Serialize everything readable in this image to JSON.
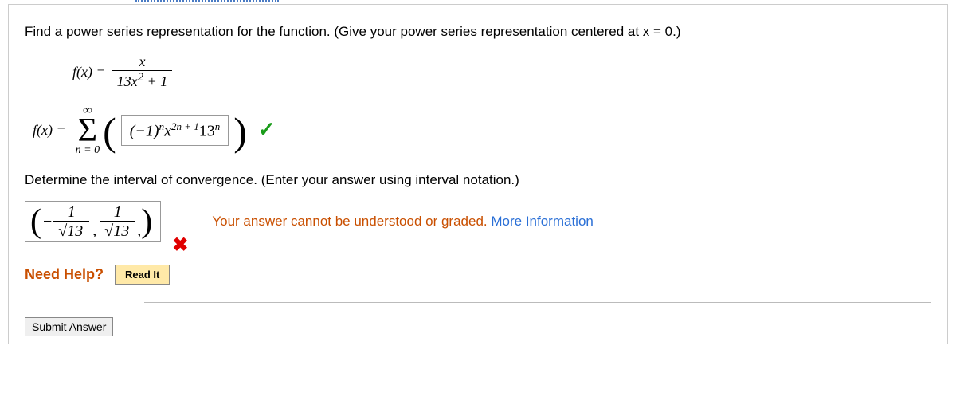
{
  "problem": {
    "prompt": "Find a power series representation for the function. (Give your power series representation centered at x = 0.)",
    "fx_equals": "f(x) =",
    "fraction": {
      "num": "x",
      "den_a": "13x",
      "den_exp": "2",
      "den_b": " + 1"
    },
    "series_label": "f(x) =",
    "sum": {
      "top": "∞",
      "bottom": "n = 0"
    },
    "series_answer": {
      "neg1": "(−1)",
      "exp1": "n",
      "x": "x",
      "exp2": "2n + 1",
      "thirteen": "13",
      "exp3": "n"
    },
    "sub_prompt": "Determine the interval of convergence. (Enter your answer using interval notation.)",
    "interval_answer": {
      "neg": "−",
      "one_a": "1",
      "root_a": "13",
      "comma": ",",
      "one_b": "1",
      "root_b": "13"
    },
    "feedback_text": "Your answer cannot be understood or graded.",
    "more_info": "More Information"
  },
  "help": {
    "label": "Need Help?",
    "read": "Read It"
  },
  "submit": "Submit Answer"
}
